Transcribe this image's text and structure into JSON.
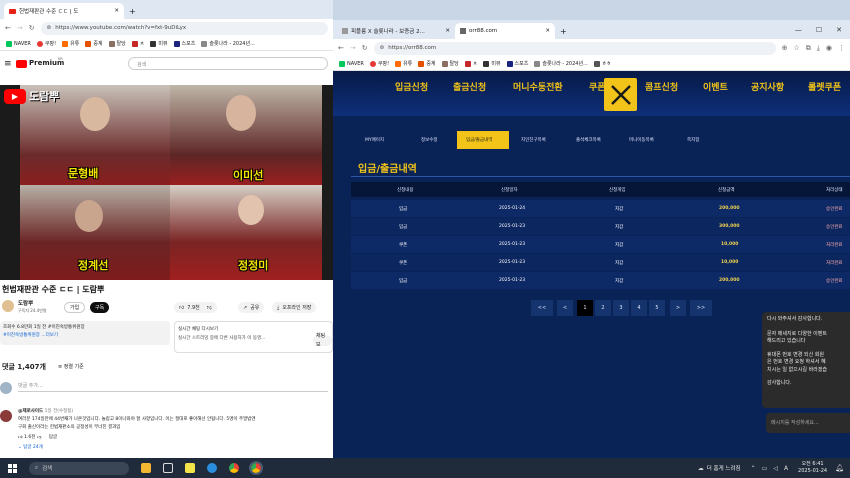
{
  "left_window": {
    "tab_title": "헌법재판관 수준 ㄷㄷ | 도",
    "url": "https://www.youtube.com/watch?v=fxt-9uDiLyx",
    "bookmarks": [
      "NAVER",
      "쿠팡!",
      "유튜",
      "중계",
      "탈당",
      "ㅊ",
      "미뷰",
      "스포츠",
      "슬롯나라 - 2024년...",
      "ㅎㅎ"
    ],
    "logo_text": "Premium",
    "logo_sup": "KR",
    "search_placeholder": "검색",
    "channel_watermark": "도람뿌",
    "judges": [
      "문형배",
      "이미선",
      "정계선",
      "정정미"
    ],
    "video_title": "헌법재판관 수준 ㄷㄷ | 도람뿌",
    "channel_name": "도람뿌",
    "subscribers": "구독자 24.4만명",
    "join_label": "가입",
    "subscribe_label": "구독",
    "like_count": "7.9천",
    "share_label": "공유",
    "offline_label": "오프라인 저장",
    "desc_line1": "조회수 6.8만회 1일 전 #이진숙방통위원장",
    "desc_line2": "#이진숙방통위원장 ...더보기",
    "live_chat_title": "실시간 채팅 다시보기",
    "live_chat_line": "실시간 스트리밍 중에 다른 사용자가 이 동영...",
    "live_chat_btn": "채팅 보",
    "comments_count": "댓글 1,407개",
    "sort_label": "정렬 기준",
    "comment_placeholder": "댓글 추가...",
    "comment_author": "@제로사이드",
    "comment_time": "1일 전(수정됨)",
    "comment_line1": "여러분 174일만에 44번째가 나온것입니다. 놀랍고 8이나와야 할 사항입니다. 이는 절대로 좋아해선 안됩니다. 5명이 주말밤엔",
    "comment_line2": "구회 출신이라는 헌법재판소의 공정성이 무너진 결과입",
    "comment_likes": "1.6천",
    "reply_label": "답글",
    "replies_label": "답글 24개"
  },
  "right_window": {
    "tabs": [
      "피플릉 X 슬롯나라 - 보증금 2...",
      "orr88.com"
    ],
    "url": "https://orr88.com",
    "bookmarks": [
      "NAVER",
      "쿠팡!",
      "유튜",
      "중계",
      "탈당",
      "ㅊ",
      "미뷰",
      "스포츠",
      "슬롯나라 - 2024년...",
      "ㅎㅎ"
    ],
    "nav": [
      "입금신청",
      "출금신청",
      "머니수동전환",
      "쿠폰",
      "콤프신청",
      "이벤트",
      "공지사항",
      "롤렛쿠폰"
    ],
    "subnav": [
      "MY페이지",
      "정보수정",
      "입금/출금내역",
      "지인친구목록",
      "출석체크목록",
      "머니이동목록",
      "쪽지함"
    ],
    "subnav_active": 2,
    "section_title": "입금/출금내역",
    "headers": [
      "신청내용",
      "신청일자",
      "신청게임",
      "신청금액",
      "처리상태"
    ],
    "rows": [
      [
        "입금",
        "2025-01-24",
        "지갑",
        "200,000",
        "승인완료"
      ],
      [
        "입금",
        "2025-01-23",
        "지갑",
        "300,000",
        "승인완료"
      ],
      [
        "쿠폰",
        "2025-01-23",
        "지갑",
        "10,000",
        "처리완료"
      ],
      [
        "쿠폰",
        "2025-01-23",
        "지갑",
        "10,000",
        "처리완료"
      ],
      [
        "입금",
        "2025-01-23",
        "지갑",
        "200,000",
        "승인완료"
      ]
    ],
    "pagination": [
      "<<",
      "<",
      "1",
      "2",
      "3",
      "4",
      "5",
      ">",
      ">>"
    ],
    "chat_messages": [
      "다시 와주셔서 감사합니다.",
      "문자 메세지로 다양한 이벤트",
      "해드리고 있습니다",
      "휴대폰 번호 변경 되신 회원",
      "은 번호 변경 요청 하셔서 혜",
      "치시는 일 없으시길 바라겠습",
      "감사합니다."
    ],
    "chat_placeholder": "메시지를 작성하세요..."
  },
  "taskbar": {
    "search": "검색",
    "weather": "더 홈게 느려짐",
    "time": "오전 6:41",
    "date": "2025-01-24"
  }
}
